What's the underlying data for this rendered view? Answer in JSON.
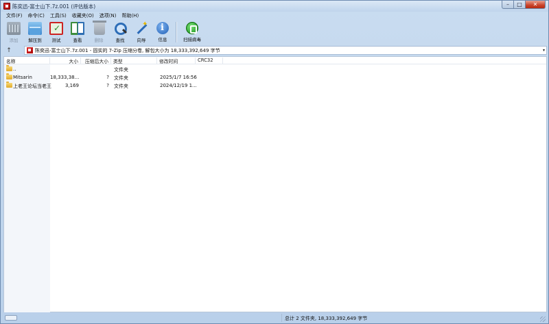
{
  "window": {
    "title": "陈奕迅-富士山下.7z.001 (评估版本)",
    "caption": {
      "minimize": "–",
      "maximize": "□",
      "close": "✕"
    }
  },
  "menu": [
    "文件(F)",
    "命令(C)",
    "工具(S)",
    "收藏夹(O)",
    "选项(N)",
    "帮助(H)"
  ],
  "toolbar": [
    {
      "id": "add",
      "label": "添加",
      "icon": "archive-add-icon",
      "enabled": false
    },
    {
      "id": "extract",
      "label": "解压到",
      "icon": "folder-extract-icon",
      "enabled": true
    },
    {
      "id": "test",
      "label": "测试",
      "icon": "test-checklist-icon",
      "enabled": true
    },
    {
      "id": "view",
      "label": "查看",
      "icon": "book-view-icon",
      "enabled": true
    },
    {
      "id": "delete",
      "label": "删除",
      "icon": "trash-icon",
      "enabled": false
    },
    {
      "id": "find",
      "label": "查找",
      "icon": "magnifier-icon",
      "enabled": true
    },
    {
      "id": "wizard",
      "label": "向导",
      "icon": "magic-wand-icon",
      "enabled": true
    },
    {
      "id": "info",
      "label": "信息",
      "icon": "info-icon",
      "enabled": true
    },
    {
      "id": "scan",
      "label": "扫描病毒",
      "icon": "virus-scan-icon",
      "enabled": true
    }
  ],
  "address": {
    "up_icon": "↑",
    "text": "陈奕迅-富士山下.7z.001 - 固实的 7-Zip 压缩分卷, 解包大小为 18,333,392,649 字节",
    "dropdown_icon": "▾"
  },
  "columns": [
    "名称",
    "大小",
    "压缩后大小",
    "类型",
    "修改时间",
    "CRC32"
  ],
  "rows": [
    {
      "name": "..",
      "size": "",
      "packed": "",
      "type": "文件夹",
      "modified": "",
      "crc": ""
    },
    {
      "name": "Mitsarin",
      "size": "18,333,38...",
      "packed": "?",
      "type": "文件夹",
      "modified": "2025/1/7 16:56",
      "crc": ""
    },
    {
      "name": "上老王论坛当老王",
      "size": "3,169",
      "packed": "?",
      "type": "文件夹",
      "modified": "2024/12/19 1...",
      "crc": ""
    }
  ],
  "status": {
    "summary": "总计 2 文件夹, 18,333,392,649 字节"
  },
  "colors": {
    "frame": "#c9dcf0",
    "list_bg": "#ffffff",
    "name_col_bg": "#f3f6fa",
    "close_red": "#c9432a"
  }
}
